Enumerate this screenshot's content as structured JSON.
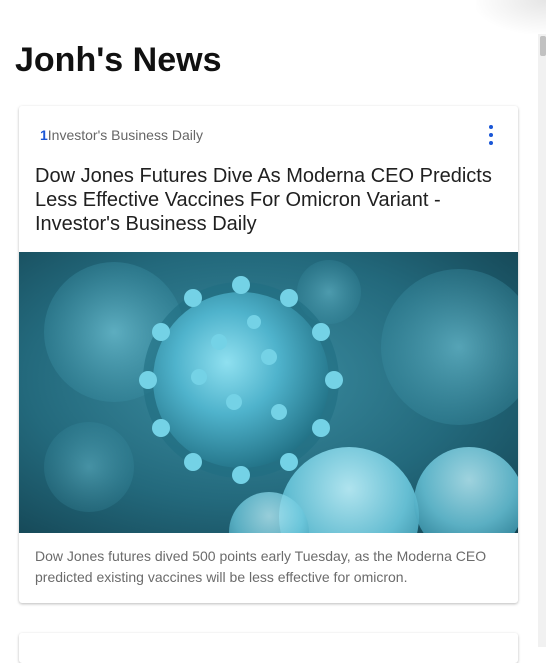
{
  "page": {
    "title": "Jonh's News"
  },
  "articles": [
    {
      "index": "1",
      "source": "Investor's Business Daily",
      "headline": "Dow Jones Futures Dive As Moderna CEO Predicts Less Effective Vaccines For Omicron Variant - Investor's Business Daily",
      "summary": "Dow Jones futures dived 500 points early Tuesday, as the Moderna CEO predicted existing vaccines will be less effective for omicron.",
      "image_icon": "coronavirus-image",
      "menu_icon": "more-vertical-icon"
    }
  ],
  "colors": {
    "accent": "#1a56d6",
    "image_bg": "#1c5a6c",
    "virus": "#5cc0d8"
  }
}
